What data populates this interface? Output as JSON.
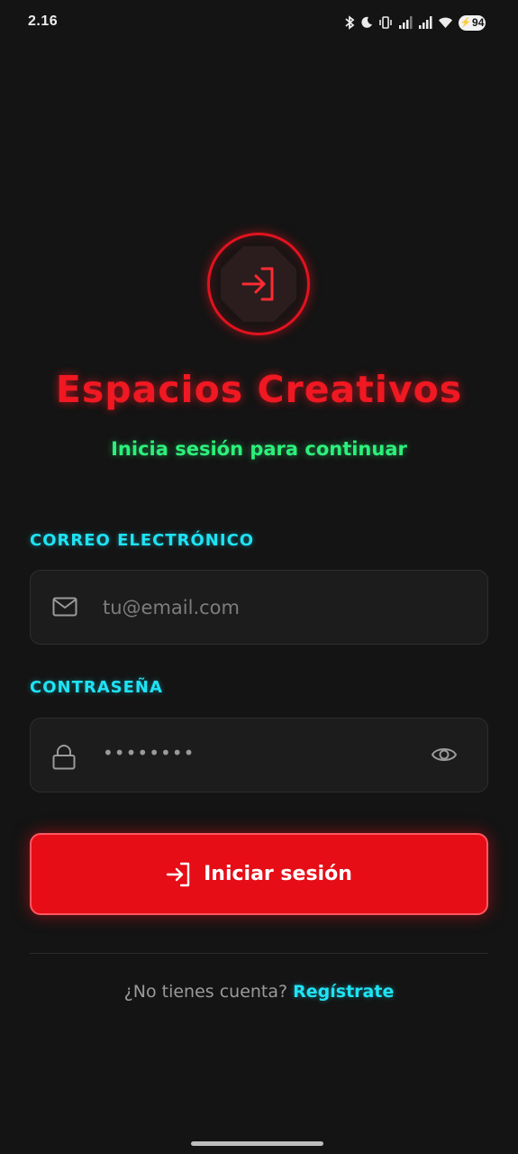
{
  "status_bar": {
    "time": "2.16",
    "battery": "94",
    "icons": [
      "bluetooth-icon",
      "moon-icon",
      "vibrate-icon",
      "signal-icon",
      "signal-icon",
      "wifi-icon",
      "battery-icon"
    ]
  },
  "brand": {
    "title": "Espacios Creativos",
    "subtitle": "Inicia sesión para continuar",
    "logo_icon": "login-icon"
  },
  "form": {
    "email_label": "CORREO ELECTRÓNICO",
    "email_placeholder": "tu@email.com",
    "email_value": "",
    "password_label": "CONTRASEÑA",
    "password_value": "••••••••",
    "submit_label": "Iniciar sesión"
  },
  "footer": {
    "prompt": "¿No tienes cuenta?",
    "link": "Regístrate"
  },
  "colors": {
    "background": "#141414",
    "accent_red": "#e60d17",
    "accent_green": "#2cf07a",
    "accent_cyan": "#1fe3f5"
  }
}
